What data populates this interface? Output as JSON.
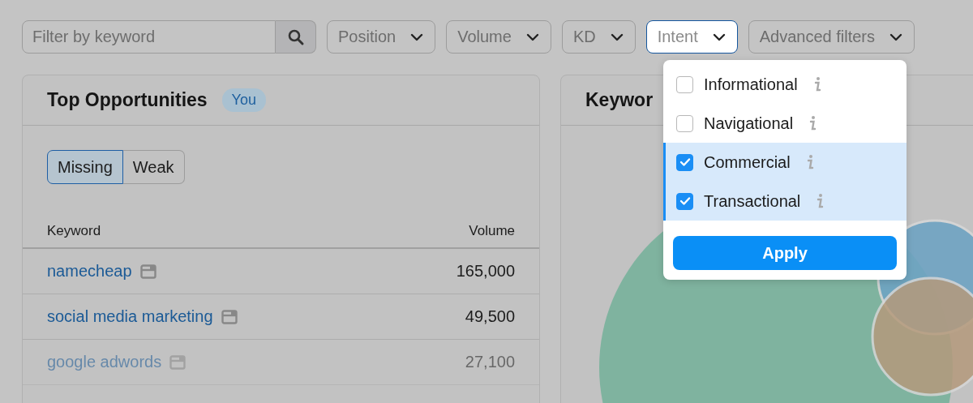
{
  "filters": {
    "search": {
      "placeholder": "Filter by keyword"
    },
    "dropdowns": [
      {
        "label": "Position",
        "open": false
      },
      {
        "label": "Volume",
        "open": false
      },
      {
        "label": "KD",
        "open": false
      },
      {
        "label": "Intent",
        "open": true
      },
      {
        "label": "Advanced filters",
        "open": false
      }
    ]
  },
  "intent_menu": {
    "options": [
      {
        "label": "Informational",
        "checked": false
      },
      {
        "label": "Navigational",
        "checked": false
      },
      {
        "label": "Commercial",
        "checked": true
      },
      {
        "label": "Transactional",
        "checked": true
      }
    ],
    "apply_button": "Apply"
  },
  "top_opportunities": {
    "title": "Top Opportunities",
    "badge": "You",
    "segments": [
      {
        "label": "Missing",
        "selected": true
      },
      {
        "label": "Weak",
        "selected": false
      }
    ],
    "columns": [
      "Keyword",
      "Volume"
    ],
    "rows": [
      {
        "keyword": "namecheap",
        "volume": "165,000"
      },
      {
        "keyword": "social media marketing",
        "volume": "49,500"
      },
      {
        "keyword": "google adwords",
        "volume": "27,100"
      }
    ]
  },
  "keyword_panel": {
    "title": "Keywor"
  }
}
